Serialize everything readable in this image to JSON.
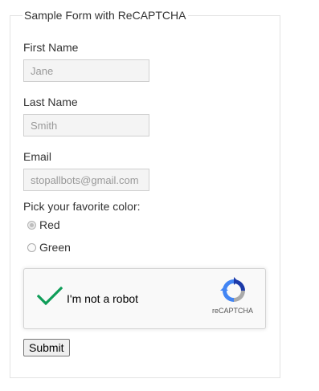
{
  "form": {
    "legend": "Sample Form with ReCAPTCHA",
    "first_name": {
      "label": "First Name",
      "placeholder": "Jane"
    },
    "last_name": {
      "label": "Last Name",
      "placeholder": "Smith"
    },
    "email": {
      "label": "Email",
      "placeholder": "stopallbots@gmail.com"
    },
    "color": {
      "prompt": "Pick your favorite color:",
      "options": [
        {
          "label": "Red",
          "selected": true
        },
        {
          "label": "Green",
          "selected": false
        }
      ]
    },
    "recaptcha": {
      "label": "I'm not a robot",
      "brand": "reCAPTCHA",
      "checked": true,
      "check_color": "#0f9d58",
      "logo_colors": [
        "#1c3aa9",
        "#4285f4",
        "#aaaaaa"
      ]
    },
    "submit_label": "Submit"
  }
}
